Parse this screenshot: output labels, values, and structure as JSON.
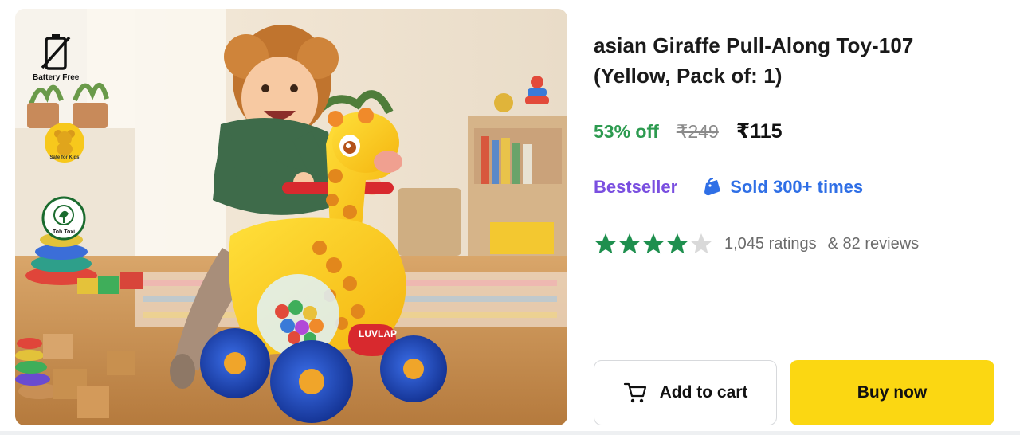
{
  "product": {
    "title": "asian Giraffe Pull-Along Toy-107 (Yellow, Pack of: 1)",
    "discount": "53% off",
    "mrp": "₹249",
    "price": "₹115",
    "bestseller": "Bestseller",
    "sold": "Sold 300+ times",
    "rating_value": 4,
    "rating_max": 5,
    "ratings": "1,045 ratings",
    "reviews": "& 82 reviews"
  },
  "image_badges": {
    "battery": "Battery Free",
    "safe": "Safe for Kids",
    "toxic": "Toh Toxi"
  },
  "toy_brand": "LUVLAP",
  "actions": {
    "cart": "Add to cart",
    "buy": "Buy now"
  },
  "colors": {
    "discount": "#2d9b50",
    "bestseller": "#7a4fe0",
    "sold": "#2f6fe6",
    "star_filled": "#1e8f4e",
    "star_empty": "#d9d9d9",
    "buy_button": "#fbd712"
  },
  "icons": {
    "battery_badge": "battery-off-icon",
    "safe_badge": "teddy-bear-icon",
    "toxic_badge": "leaf-icon",
    "sold": "shopping-bag-icon",
    "cart": "cart-icon",
    "star": "star-icon"
  }
}
